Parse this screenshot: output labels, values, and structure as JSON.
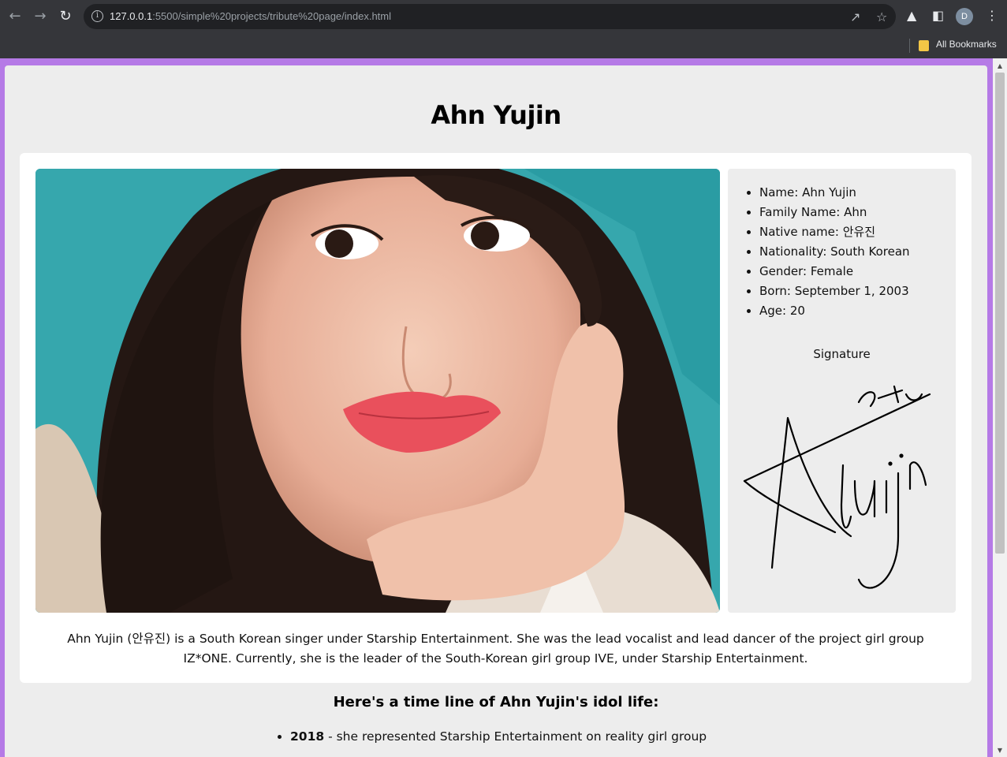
{
  "browser": {
    "url_host": "127.0.0.1",
    "url_rest": ":5500/simple%20projects/tribute%20page/index.html",
    "avatar_letter": "D",
    "bookmarks_label": "All Bookmarks"
  },
  "page": {
    "title": "Ahn Yujin",
    "facts": [
      "Name: Ahn Yujin",
      "Family Name: Ahn",
      "Native name: 안유진",
      "Nationality: South Korean",
      "Gender: Female",
      "Born: September 1, 2003",
      "Age: 20"
    ],
    "signature_label": "Signature",
    "description": "Ahn Yujin (안유진) is a South Korean singer under Starship Entertainment. She was the lead vocalist and lead dancer of the project girl group IZ*ONE. Currently, she is the leader of the South-Korean girl group IVE, under Starship Entertainment.",
    "timeline_title": "Here's a time line of Ahn Yujin's idol life:",
    "timeline": [
      {
        "year": "2018",
        "text": " - she represented Starship Entertainment on reality girl group"
      }
    ]
  },
  "colors": {
    "page_border": "#b57ae6",
    "page_bg": "#ededed",
    "card_bg": "#ffffff"
  }
}
